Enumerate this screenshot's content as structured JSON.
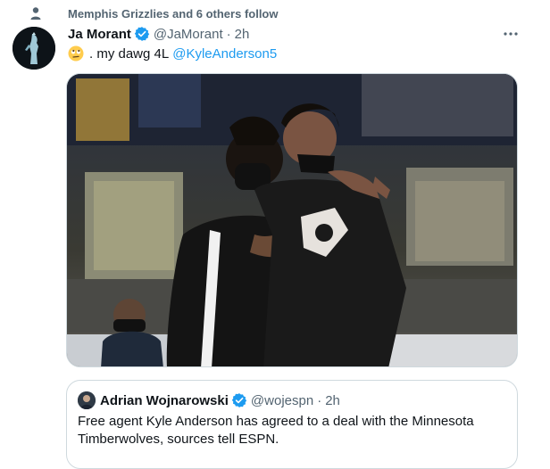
{
  "social_context": {
    "text": "Memphis Grizzlies and 6 others follow",
    "icon": "person-icon"
  },
  "tweet": {
    "author_name": "Ja Morant",
    "handle": "@JaMorant",
    "separator": "·",
    "time": "2h",
    "text": ". my dawg 4L",
    "mention": "@KyleAnderson5",
    "emoji": "rolling-eyes-emoji"
  },
  "quote": {
    "author_name": "Adrian Wojnarowski",
    "handle": "@wojespn",
    "separator": "·",
    "time": "2h",
    "text": "Free agent Kyle Anderson has agreed to a deal with the Minnesota Timberwolves, sources tell ESPN."
  },
  "colors": {
    "link": "#1d9bf0",
    "verified": "#1d9bf0",
    "muted": "#536471",
    "border": "#cfd9de"
  }
}
